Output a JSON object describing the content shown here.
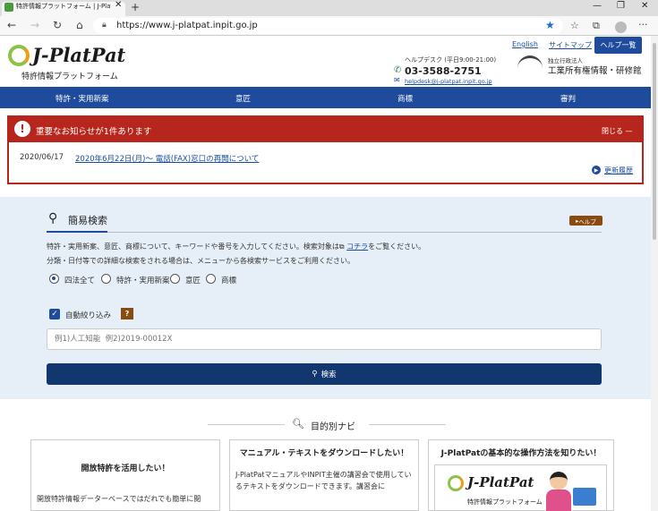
{
  "browser": {
    "tab_title": "特許情報プラットフォーム | J-PlatPat",
    "tab_close": "✕",
    "new_tab": "+",
    "url": "https://www.j-platpat.inpit.go.jp",
    "icons": [
      "back-icon",
      "forward-icon",
      "refresh-icon",
      "home-icon",
      "lock-icon",
      "star-icon",
      "favorites-icon",
      "collections-icon",
      "profile-icon",
      "menu-icon"
    ]
  },
  "header": {
    "logo_text": "J-PlatPat",
    "logo_sub": "特許情報プラットフォーム",
    "links": {
      "english": "English",
      "sitemap": "サイトマップ"
    },
    "help_button": "ヘルプ一覧",
    "helpdesk_label": "ヘルプデスク (平日9:00-21:00)",
    "helpdesk_phone": "03-3588-2751",
    "helpdesk_mail": "helpdesk@j-platpat.inpit.go.jp",
    "inpit_small": "独立行政法人",
    "inpit_name": "工業所有権情報・研修館"
  },
  "nav": {
    "items": [
      "特許・実用新案",
      "意匠",
      "商標",
      "審判"
    ]
  },
  "notice": {
    "title": "重要なお知らせが1件あります",
    "close": "閉じる —",
    "date": "2020/06/17",
    "link": "2020年6月22日(月)～ 電話(FAX)窓口の再開について",
    "history": "更新履歴"
  },
  "search": {
    "title": "簡易検索",
    "help": "ヘルプ",
    "desc1_pre": "特許・実用新案、意匠、商標について、キーワードや番号を入力してください。検索対象は",
    "desc1_link": "コチラ",
    "desc1_post": "をご覧ください。",
    "desc2": "分類・日付等での詳細な検索をされる場合は、メニューから各検索サービスをご利用ください。",
    "radios": [
      "四法全て",
      "特許・実用新案",
      "意匠",
      "商標"
    ],
    "selected_radio": "四法全て",
    "auto_filter": "自動絞り込み",
    "auto_filter_checked": true,
    "help_badge": "?",
    "placeholder": "例1)人工知能  例2)2019-00012X",
    "value": "",
    "button": "検索"
  },
  "purpose": {
    "title": "目的別ナビ",
    "cards": [
      {
        "title": "開放特許を活用したい！",
        "body": "開放特許情報データーベースではだれでも簡単に閲"
      },
      {
        "title": "マニュアル・テキストをダウンロードしたい！",
        "body": "J-PlatPatマニュアルやINPIT主催の講習会で使用しているテキストをダウンロードできます。講習会に"
      },
      {
        "title": "J-PlatPatの基本的な操作方法を知りたい！",
        "banner_logo": "J-PlatPat",
        "banner_sub": "特許情報プラットフォーム"
      }
    ]
  }
}
